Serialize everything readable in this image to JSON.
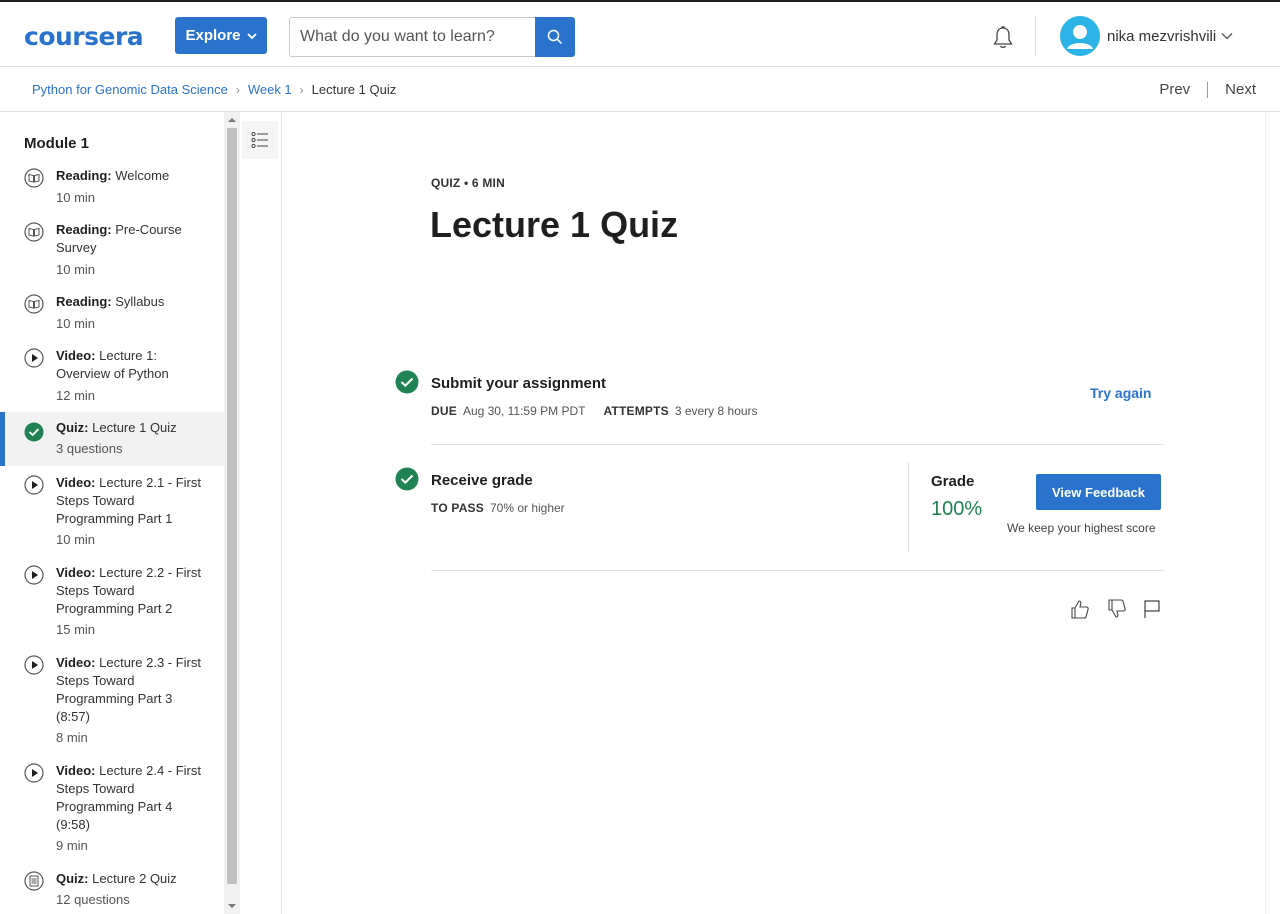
{
  "header": {
    "logo_text": "coursera",
    "explore_label": "Explore",
    "search_placeholder": "What do you want to learn?",
    "username": "nika mezvrishvili"
  },
  "breadcrumb": {
    "course": "Python for Genomic Data Science",
    "week": "Week 1",
    "current": "Lecture 1 Quiz",
    "prev": "Prev",
    "next": "Next"
  },
  "sidebar": {
    "module_title": "Module 1",
    "items": [
      {
        "type": "Reading:",
        "title": "Welcome",
        "duration": "10 min",
        "icon": "book-icon"
      },
      {
        "type": "Reading:",
        "title": "Pre-Course Survey",
        "duration": "10 min",
        "icon": "book-icon"
      },
      {
        "type": "Reading:",
        "title": "Syllabus",
        "duration": "10 min",
        "icon": "book-icon"
      },
      {
        "type": "Video:",
        "title": "Lecture 1: Overview of Python",
        "duration": "12 min",
        "icon": "play-icon"
      },
      {
        "type": "Quiz:",
        "title": "Lecture 1 Quiz",
        "duration": "3 questions",
        "icon": "check-circle-icon"
      },
      {
        "type": "Video:",
        "title": "Lecture 2.1 - First Steps Toward Programming Part 1",
        "duration": "10 min",
        "icon": "play-icon"
      },
      {
        "type": "Video:",
        "title": "Lecture 2.2 - First Steps Toward Programming Part 2",
        "duration": "15 min",
        "icon": "play-icon"
      },
      {
        "type": "Video:",
        "title": "Lecture 2.3 - First Steps Toward Programming Part 3 (8:57)",
        "duration": "8 min",
        "icon": "play-icon"
      },
      {
        "type": "Video:",
        "title": "Lecture 2.4 - First Steps Toward Programming Part 4 (9:58)",
        "duration": "9 min",
        "icon": "play-icon"
      },
      {
        "type": "Quiz:",
        "title": "Lecture 2 Quiz",
        "duration": "12 questions",
        "icon": "quiz-icon"
      }
    ]
  },
  "quiz": {
    "meta": "QUIZ • 6 MIN",
    "title": "Lecture 1 Quiz",
    "submit": {
      "title": "Submit your assignment",
      "due_label": "DUE",
      "due_value": "Aug 30, 11:59 PM PDT",
      "attempts_label": "ATTEMPTS",
      "attempts_value": "3 every 8 hours",
      "try_again": "Try again"
    },
    "receive": {
      "title": "Receive grade",
      "pass_label": "TO PASS",
      "pass_value": "70% or higher",
      "grade_label": "Grade",
      "grade_value": "100%",
      "feedback_button": "View Feedback",
      "keep_note": "We keep your highest score"
    }
  },
  "colors": {
    "brand_blue": "#2a73cc",
    "success_green": "#1f8354",
    "avatar_bg": "#2bb3e8"
  }
}
